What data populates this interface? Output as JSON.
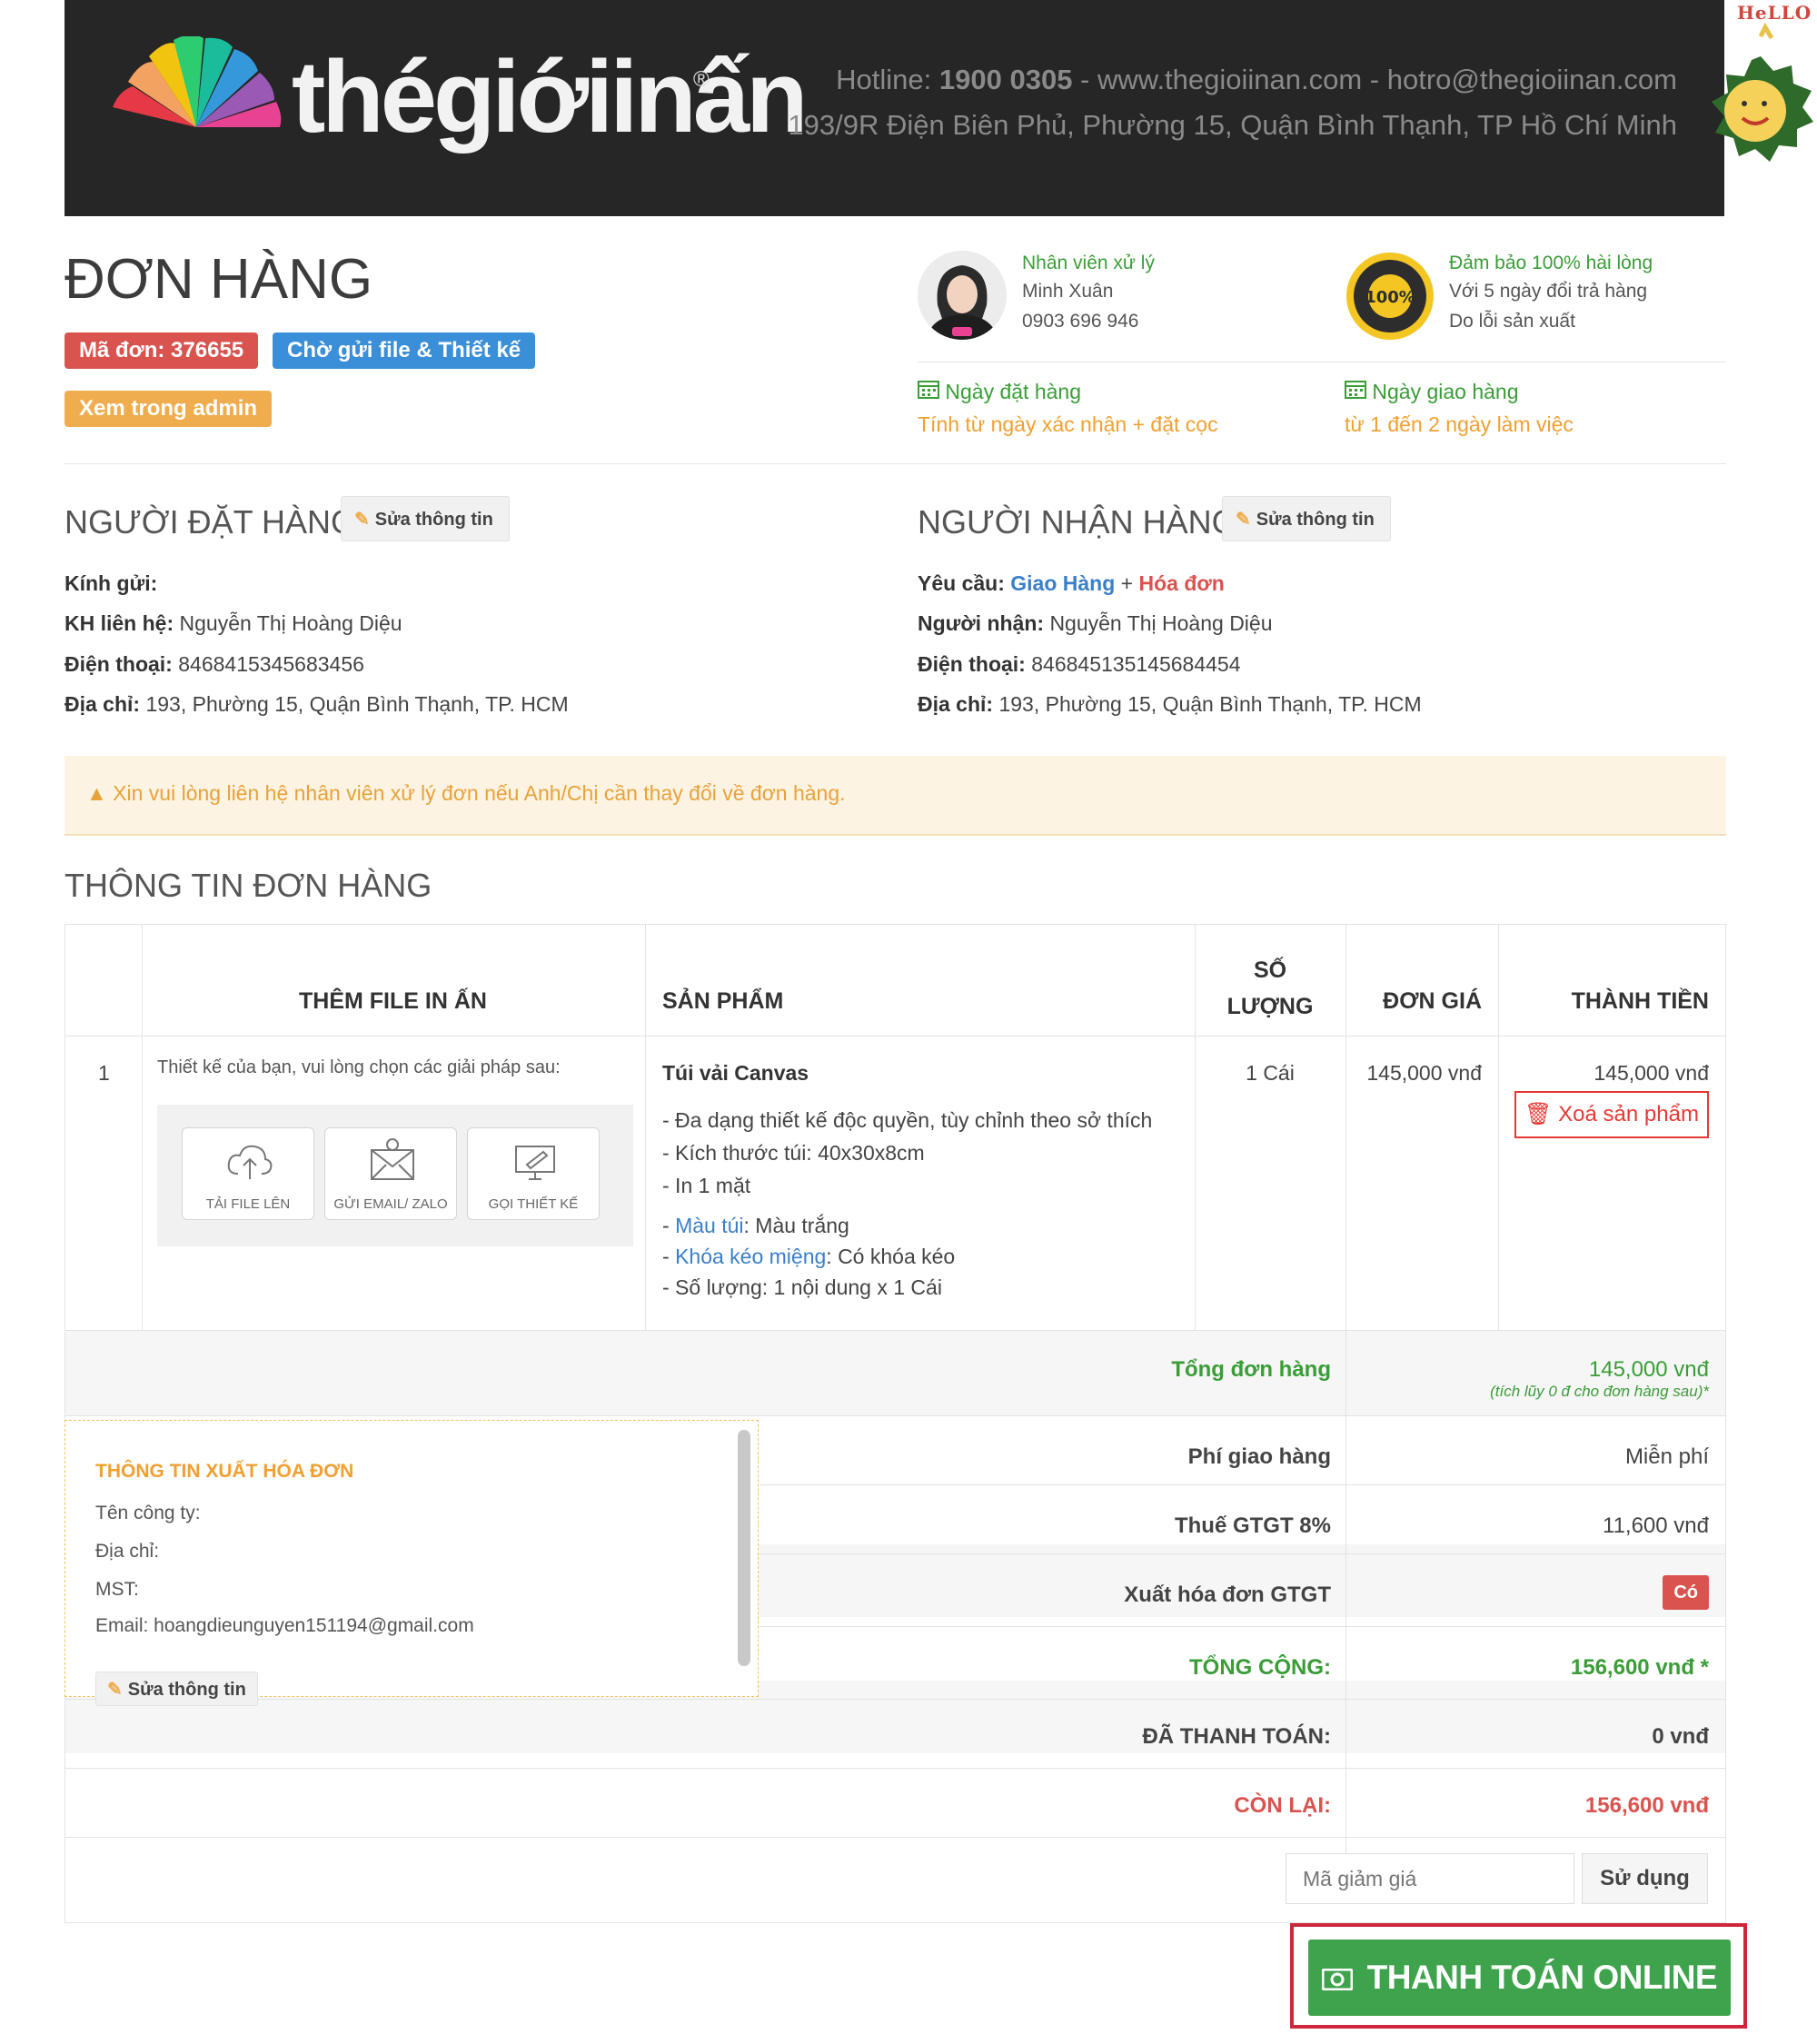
{
  "header": {
    "brand": "thégiớiinấn",
    "registered": "®",
    "hotline_label": "Hotline:",
    "hotline_number": "1900 0305",
    "contact_rest": " - www.thegioiinan.com - hotro@thegioiinan.com",
    "address": "193/9R Điện Biên Phủ, Phường 15, Quận Bình Thạnh, TP Hồ Chí Minh",
    "mascot_text": "HeLLO"
  },
  "order": {
    "title": "ĐƠN HÀNG",
    "code_label": "Mã đơn: 376655",
    "status_label": "Chờ gửi file & Thiết kế",
    "admin_button": "Xem trong admin"
  },
  "staff": {
    "label": "Nhân viên xử lý",
    "name": "Minh Xuân",
    "phone": "0903 696 946"
  },
  "guarantee": {
    "title": "Đảm bảo 100% hài lòng",
    "line1": "Với 5 ngày đổi trả hàng",
    "line2": "Do lỗi sản xuất",
    "badge_text": "100%"
  },
  "dates": {
    "order_date_label": "Ngày đặt hàng",
    "order_date_note": "Tính từ ngày xác nhận + đặt cọc",
    "delivery_date_label": "Ngày giao hàng",
    "delivery_date_note": "từ 1 đến 2 ngày làm việc"
  },
  "orderer": {
    "title": "NGƯỜI ĐẶT HÀNG",
    "edit": "Sửa thông tin",
    "greeting_label": "Kính gửi:",
    "contact_label": "KH liên hệ:",
    "contact_value": "Nguyễn Thị Hoàng Diệu",
    "phone_label": "Điện thoại:",
    "phone_value": "8468415345683456",
    "address_label": "Địa chỉ:",
    "address_value": "193, Phường 15, Quận Bình Thạnh, TP. HCM"
  },
  "receiver": {
    "title": "NGƯỜI NHẬN HÀNG",
    "edit": "Sửa thông tin",
    "request_label": "Yêu cầu:",
    "request_delivery": "Giao Hàng",
    "request_plus": "+",
    "request_invoice": "Hóa đơn",
    "name_label": "Người nhận:",
    "name_value": "Nguyễn Thị Hoàng Diệu",
    "phone_label": "Điện thoại:",
    "phone_value": "846845135145684454",
    "address_label": "Địa chỉ:",
    "address_value": "193, Phường 15, Quận Bình Thạnh, TP. HCM"
  },
  "alert": {
    "text": "Xin vui lòng liên hệ nhân viên xử lý đơn nếu Anh/Chị cần thay đổi về đơn hàng."
  },
  "order_info": {
    "title": "THÔNG TIN ĐƠN HÀNG",
    "columns": {
      "file": "THÊM FILE IN ẤN",
      "product": "SẢN PHẨM",
      "qty_line1": "SỐ",
      "qty_line2": "LƯỢNG",
      "unit_price": "ĐƠN GIÁ",
      "total": "THÀNH TIỀN"
    },
    "item": {
      "index": "1",
      "design_prompt": "Thiết kế của bạn, vui lòng chọn các giải pháp sau:",
      "options": [
        "TẢI FILE LÊN",
        "GỬI EMAIL/ ZALO",
        "GỌI THIẾT KẾ"
      ],
      "product_name": "Túi vải Canvas",
      "features": [
        "- Đa dạng thiết kế độc quyền, tùy chỉnh theo sở thích",
        "- Kích thước túi: 40x30x8cm",
        "- In 1 mặt"
      ],
      "attributes": [
        {
          "prefix": "- ",
          "name": "Màu túi",
          "value": ": Màu trắng"
        },
        {
          "prefix": "- ",
          "name": "Khóa kéo miệng",
          "value": ": Có khóa kéo"
        }
      ],
      "quantity_note": "- Số lượng: 1 nội dung x 1 Cái",
      "qty": "1 Cái",
      "unit_price": "145,000 vnđ",
      "total": "145,000 vnđ",
      "delete": "Xoá sản phẩm"
    }
  },
  "summary": {
    "subtotal_label": "Tổng đơn hàng",
    "subtotal_value": "145,000 vnđ",
    "subtotal_note": "(tích lũy 0 đ cho đơn hàng sau)*",
    "shipping_label": "Phí giao hàng",
    "shipping_value": "Miễn phí",
    "vat_label": "Thuế GTGT 8%",
    "vat_value": "11,600 vnđ",
    "invoice_label": "Xuất hóa đơn GTGT",
    "invoice_value": "Có",
    "grand_label": "TỔNG CỘNG:",
    "grand_value": "156,600 vnđ *",
    "paid_label": "ĐÃ THANH TOÁN:",
    "paid_value": "0 vnđ",
    "remaining_label": "CÒN LẠI:",
    "remaining_value": "156,600 vnđ"
  },
  "invoice_info": {
    "title": "THÔNG TIN XUẤT HÓA ĐƠN",
    "company": "Tên công ty:",
    "address": "Địa chỉ:",
    "tax": "MST:",
    "email": "Email: hoangdieunguyen151194@gmail.com",
    "edit": "Sửa thông tin"
  },
  "coupon": {
    "placeholder": "Mã giảm giá",
    "apply": "Sử dụng"
  },
  "payment": {
    "online": "THANH TOÁN ONLINE"
  },
  "colors": {
    "success": "#3a9d37",
    "warning": "#f0ad4e",
    "danger": "#d9534f",
    "primary": "#3b8fd8",
    "header_bg": "#262626"
  }
}
